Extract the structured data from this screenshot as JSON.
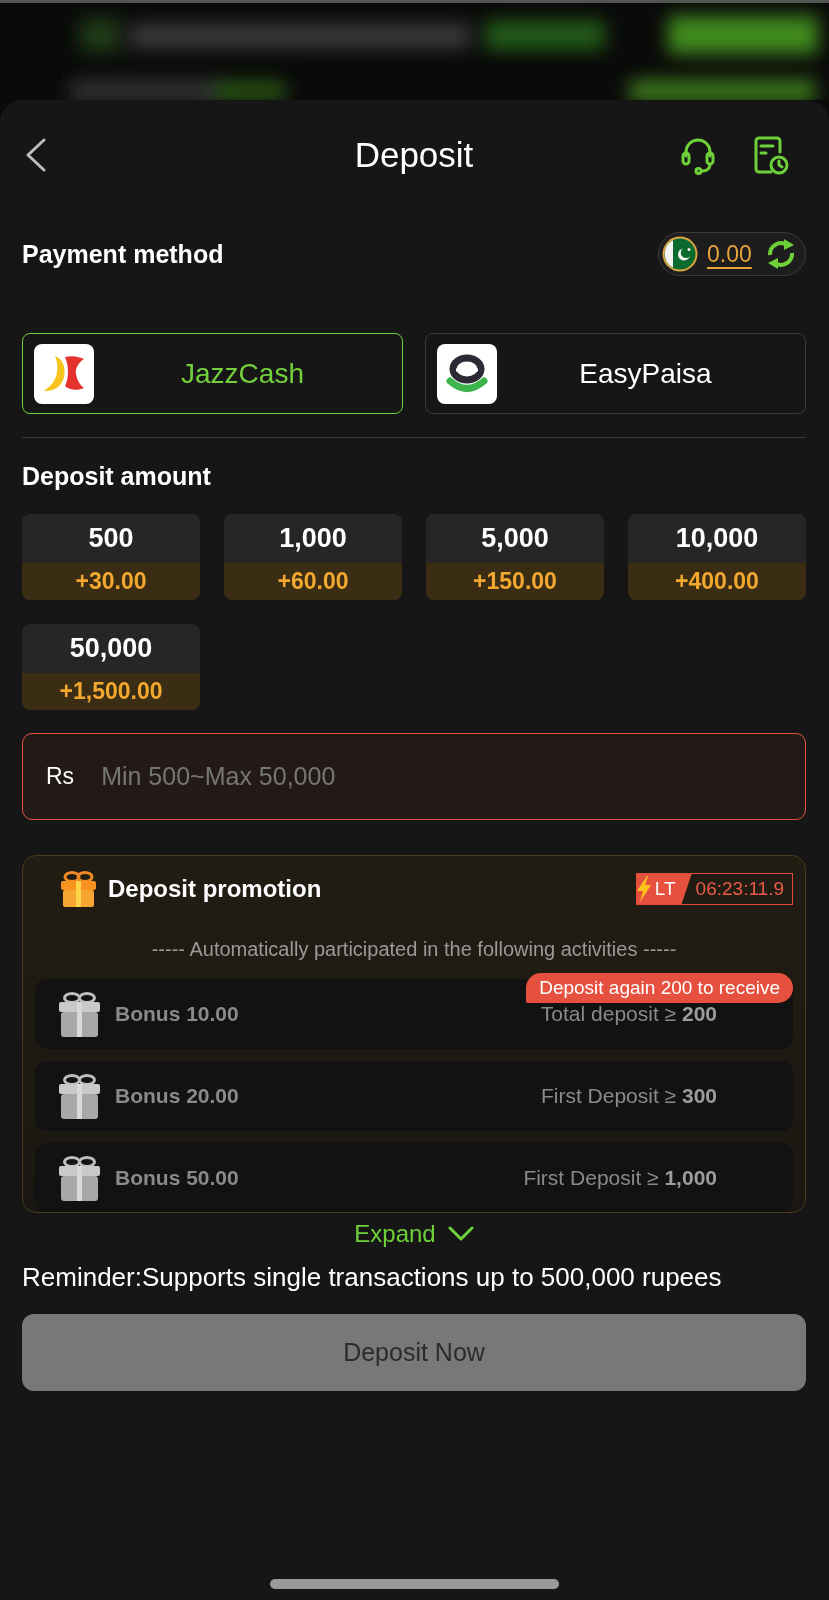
{
  "header": {
    "title": "Deposit"
  },
  "payment": {
    "label": "Payment method",
    "balance": "0.00",
    "methods": [
      {
        "kind": "jazzcash",
        "name": "JazzCash",
        "selected": true
      },
      {
        "kind": "easypaisa",
        "name": "EasyPaisa",
        "selected": false
      }
    ]
  },
  "amounts": {
    "label": "Deposit amount",
    "options": [
      {
        "amount": "500",
        "bonus": "+30.00",
        "selected": false
      },
      {
        "amount": "1,000",
        "bonus": "+60.00",
        "selected": false
      },
      {
        "amount": "5,000",
        "bonus": "+150.00",
        "selected": false
      },
      {
        "amount": "10,000",
        "bonus": "+400.00",
        "selected": false
      },
      {
        "amount": "50,000",
        "bonus": "+1,500.00",
        "selected": false
      }
    ]
  },
  "amount_input": {
    "prefix": "Rs",
    "placeholder": "Min 500~Max 50,000",
    "invalid": true
  },
  "promotion": {
    "title": "Deposit promotion",
    "tag": "LT",
    "countdown": "06:23:11.9",
    "subtitle": "----- Automatically participated in the following activities -----",
    "activities": [
      {
        "bonus": "Bonus 10.00",
        "condition": "Total deposit ≥ **200**",
        "tooltip": "Deposit again 200 to receive"
      },
      {
        "bonus": "Bonus 20.00",
        "condition": "First Deposit ≥ **300**"
      },
      {
        "bonus": "Bonus 50.00",
        "condition": "First Deposit ≥ **1,000**"
      }
    ]
  },
  "expand": {
    "label": "Expand",
    "expanded": false
  },
  "reminder": "Reminder:Supports single transactions up to 500,000 rupees",
  "submit": {
    "label": "Deposit Now",
    "disabled": true
  }
}
